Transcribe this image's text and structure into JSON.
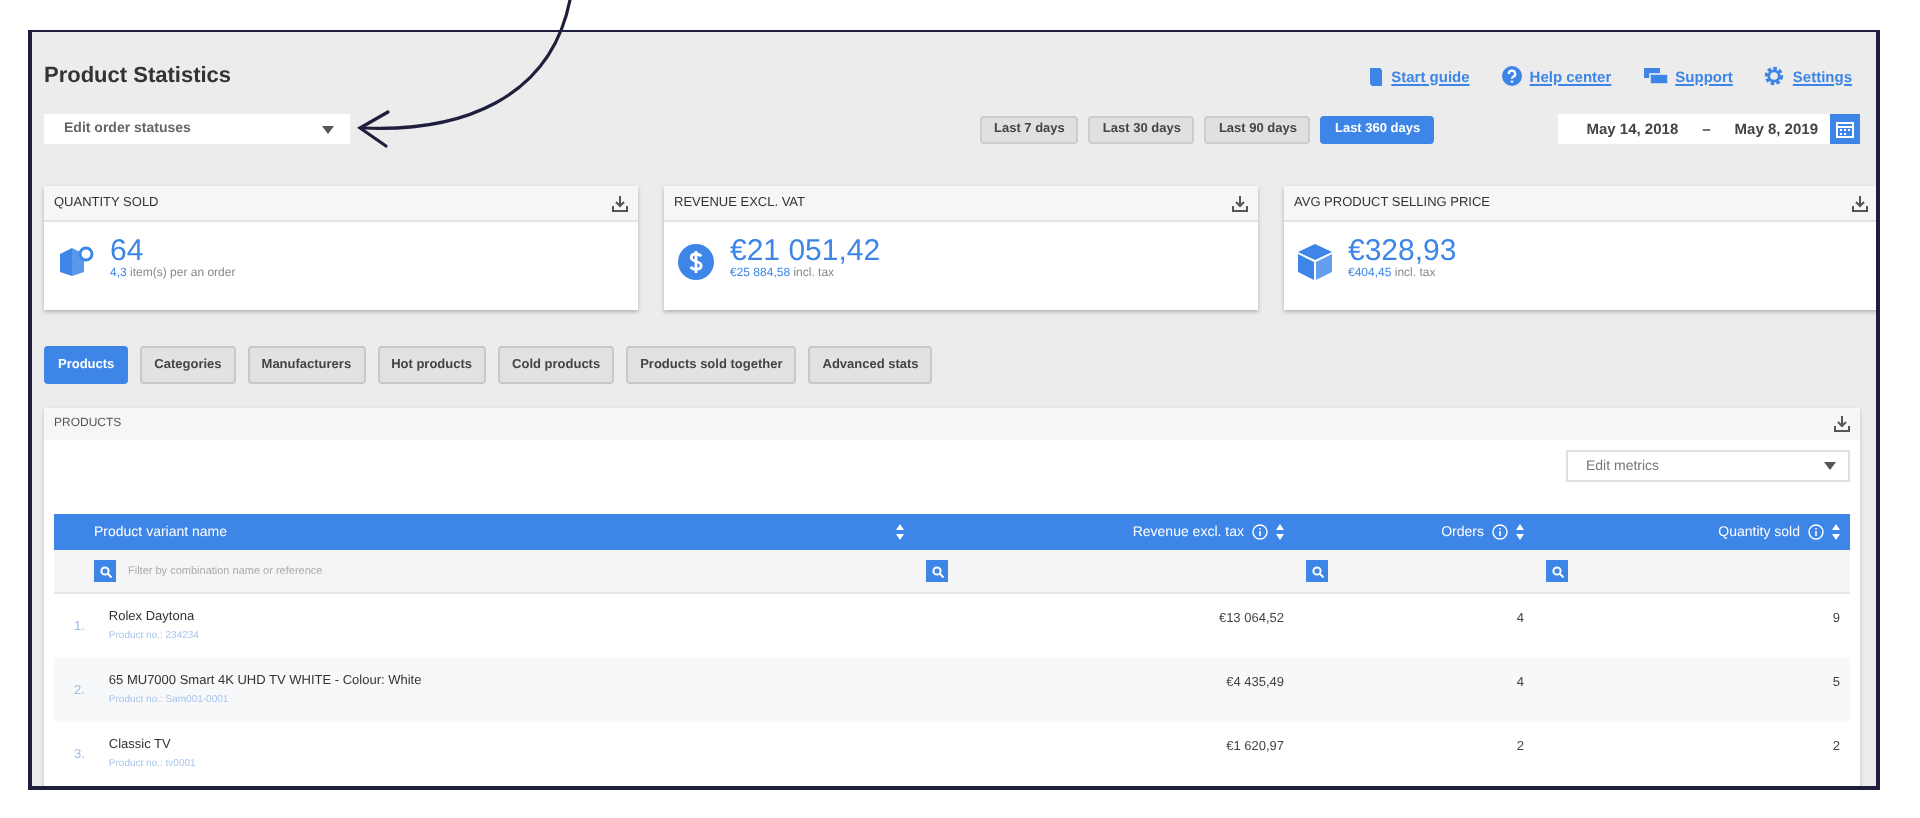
{
  "title": "Product Statistics",
  "links": [
    {
      "label": "Start guide",
      "kind": "guide"
    },
    {
      "label": "Help center",
      "kind": "help"
    },
    {
      "label": "Support",
      "kind": "support"
    },
    {
      "label": "Settings",
      "kind": "settings"
    }
  ],
  "order_status_select": {
    "label": "Edit order statuses"
  },
  "periods": [
    {
      "label": "Last 7 days",
      "selected": false
    },
    {
      "label": "Last 30 days",
      "selected": false
    },
    {
      "label": "Last 90 days",
      "selected": false
    },
    {
      "label": "Last 360 days",
      "selected": true
    }
  ],
  "date_range": {
    "from": "May 14, 2018",
    "separator": "–",
    "to": "May 8, 2019"
  },
  "kpis": [
    {
      "title": "QUANTITY SOLD",
      "kind": "boxes",
      "value": "64",
      "sub_value": "4,3",
      "sub_label": "item(s) per an order"
    },
    {
      "title": "REVENUE EXCL. VAT",
      "kind": "coin",
      "value": "€21 051,42",
      "sub_value": "€25 884,58",
      "sub_label": "incl. tax"
    },
    {
      "title": "AVG PRODUCT SELLING PRICE",
      "kind": "cube",
      "value": "€328,93",
      "sub_value": "€404,45",
      "sub_label": "incl. tax"
    }
  ],
  "tabs": [
    {
      "label": "Products",
      "selected": true
    },
    {
      "label": "Categories",
      "selected": false
    },
    {
      "label": "Manufacturers",
      "selected": false
    },
    {
      "label": "Hot products",
      "selected": false
    },
    {
      "label": "Cold products",
      "selected": false
    },
    {
      "label": "Products sold together",
      "selected": false
    },
    {
      "label": "Advanced stats",
      "selected": false
    }
  ],
  "products": {
    "title": "PRODUCTS",
    "metrics_select": {
      "label": "Edit metrics"
    },
    "filter": {
      "placeholder": "Filter by combination name or reference"
    },
    "columns": [
      {
        "label": "Product variant name",
        "info": false
      },
      {
        "label": "Revenue excl. tax",
        "info": true
      },
      {
        "label": "Orders",
        "info": true
      },
      {
        "label": "Quantity sold",
        "info": true
      }
    ],
    "rows": [
      {
        "index": "1.",
        "name": "Rolex Daytona",
        "ref": "Product no.: 234234",
        "revenue": "€13 064,52",
        "orders": "4",
        "quantity": "9"
      },
      {
        "index": "2.",
        "name": "65 MU7000 Smart 4K UHD TV WHITE - Colour: White",
        "ref": "Product no.: Sam001-0001",
        "revenue": "€4 435,49",
        "orders": "4",
        "quantity": "5"
      },
      {
        "index": "3.",
        "name": "Classic TV",
        "ref": "Product no.: tv0001",
        "revenue": "€1 620,97",
        "orders": "2",
        "quantity": "2"
      }
    ]
  }
}
